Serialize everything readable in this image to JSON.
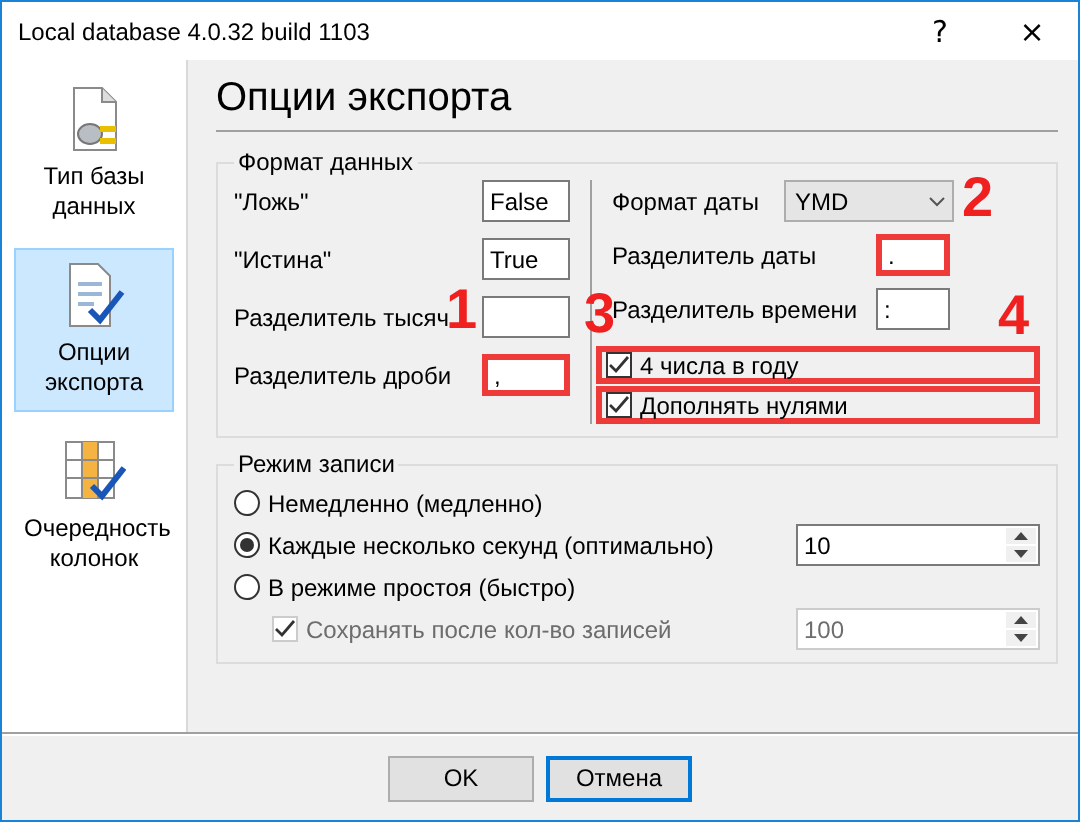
{
  "window": {
    "title": "Local database 4.0.32 build 1103",
    "help": "?",
    "close": "×"
  },
  "sidebar": {
    "items": [
      {
        "label": "Тип базы данных",
        "kind": "database",
        "selected": false
      },
      {
        "label": "Опции экспорта",
        "kind": "export",
        "selected": true
      },
      {
        "label": "Очередность колонок",
        "kind": "columns",
        "selected": false
      }
    ]
  },
  "page_title": "Опции экспорта",
  "data_format": {
    "title": "Формат данных",
    "fields": [
      {
        "label": "\"Ложь\"",
        "value": "False",
        "highlighted": false
      },
      {
        "label": "\"Истина\"",
        "value": "True",
        "highlighted": false
      },
      {
        "label": "Разделитель тысяч",
        "highlighted": false
      },
      {
        "label": "Разделитель дроби",
        "value": ",",
        "highlighted": true
      }
    ],
    "date_format": {
      "label": "Формат даты",
      "value": "YMD"
    },
    "date_fields": [
      {
        "label": "Разделитель даты",
        "value": ".",
        "highlighted": true
      },
      {
        "label": "Разделитель времени",
        "value": ":",
        "highlighted": false
      }
    ],
    "checkboxes": [
      {
        "label": "4 числа в году",
        "checked": true,
        "highlighted": true
      },
      {
        "label": "Дополнять нулями",
        "checked": true,
        "highlighted": true
      }
    ]
  },
  "write_mode": {
    "title": "Режим записи",
    "options": [
      {
        "label": "Немедленно (медленно)",
        "selected": false
      },
      {
        "label": "Каждые несколько секунд (оптимально)",
        "selected": true,
        "value": "10"
      },
      {
        "label": "В режиме простоя (быстро)",
        "selected": false
      }
    ],
    "sub_option": {
      "label": "Сохранять после кол-во записей",
      "checked": true,
      "disabled": true,
      "value": "100"
    }
  },
  "annotations": [
    "1",
    "2",
    "3",
    "4"
  ],
  "buttons": [
    {
      "label": "OK",
      "focused": false
    },
    {
      "label": "Отмена",
      "focused": true
    }
  ]
}
